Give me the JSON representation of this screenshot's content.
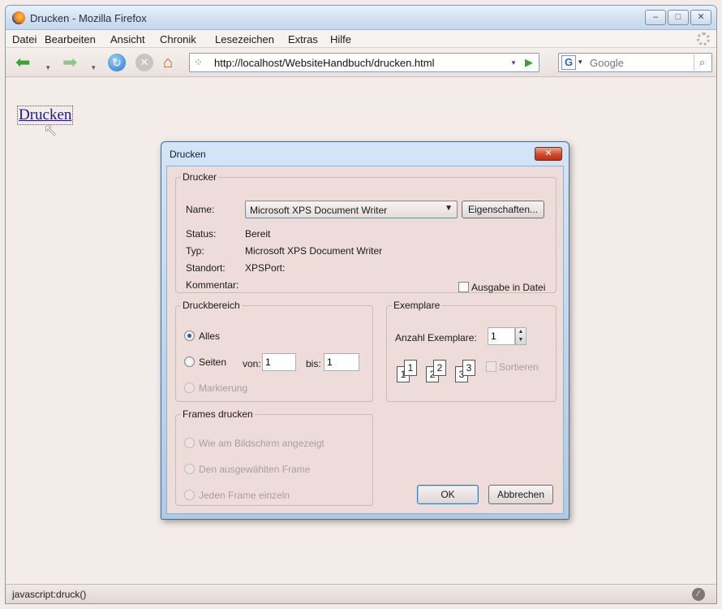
{
  "window": {
    "title": "Drucken - Mozilla Firefox",
    "controls": {
      "minimize": "–",
      "maximize": "□",
      "close": "✕"
    }
  },
  "menu": {
    "items": [
      "Datei",
      "Bearbeiten",
      "Ansicht",
      "Chronik",
      "Lesezeichen",
      "Extras",
      "Hilfe"
    ]
  },
  "navbar": {
    "url": "http://localhost/WebsiteHandbuch/drucken.html",
    "search_engine": "G",
    "search_placeholder": "Google"
  },
  "page": {
    "link_text": "Drucken"
  },
  "status": {
    "text": "javascript:druck()"
  },
  "dialog": {
    "title": "Drucken",
    "printer": {
      "legend": "Drucker",
      "name_label": "Name:",
      "name_value": "Microsoft XPS Document Writer",
      "properties_button": "Eigenschaften...",
      "status_label": "Status:",
      "status_value": "Bereit",
      "type_label": "Typ:",
      "type_value": "Microsoft XPS Document Writer",
      "location_label": "Standort:",
      "location_value": "XPSPort:",
      "comment_label": "Kommentar:",
      "print_to_file": "Ausgabe in Datei"
    },
    "range": {
      "legend": "Druckbereich",
      "all": "Alles",
      "pages": "Seiten",
      "from_label": "von:",
      "from_value": "1",
      "to_label": "bis:",
      "to_value": "1",
      "selection": "Markierung"
    },
    "copies": {
      "legend": "Exemplare",
      "count_label": "Anzahl Exemplare:",
      "count_value": "1",
      "collate": "Sortieren"
    },
    "frames": {
      "legend": "Frames drucken",
      "as_shown": "Wie am Bildschirm angezeigt",
      "selected": "Den ausgewählten Frame",
      "each": "Jeden Frame einzeln"
    },
    "ok_button": "OK",
    "cancel_button": "Abbrechen"
  }
}
